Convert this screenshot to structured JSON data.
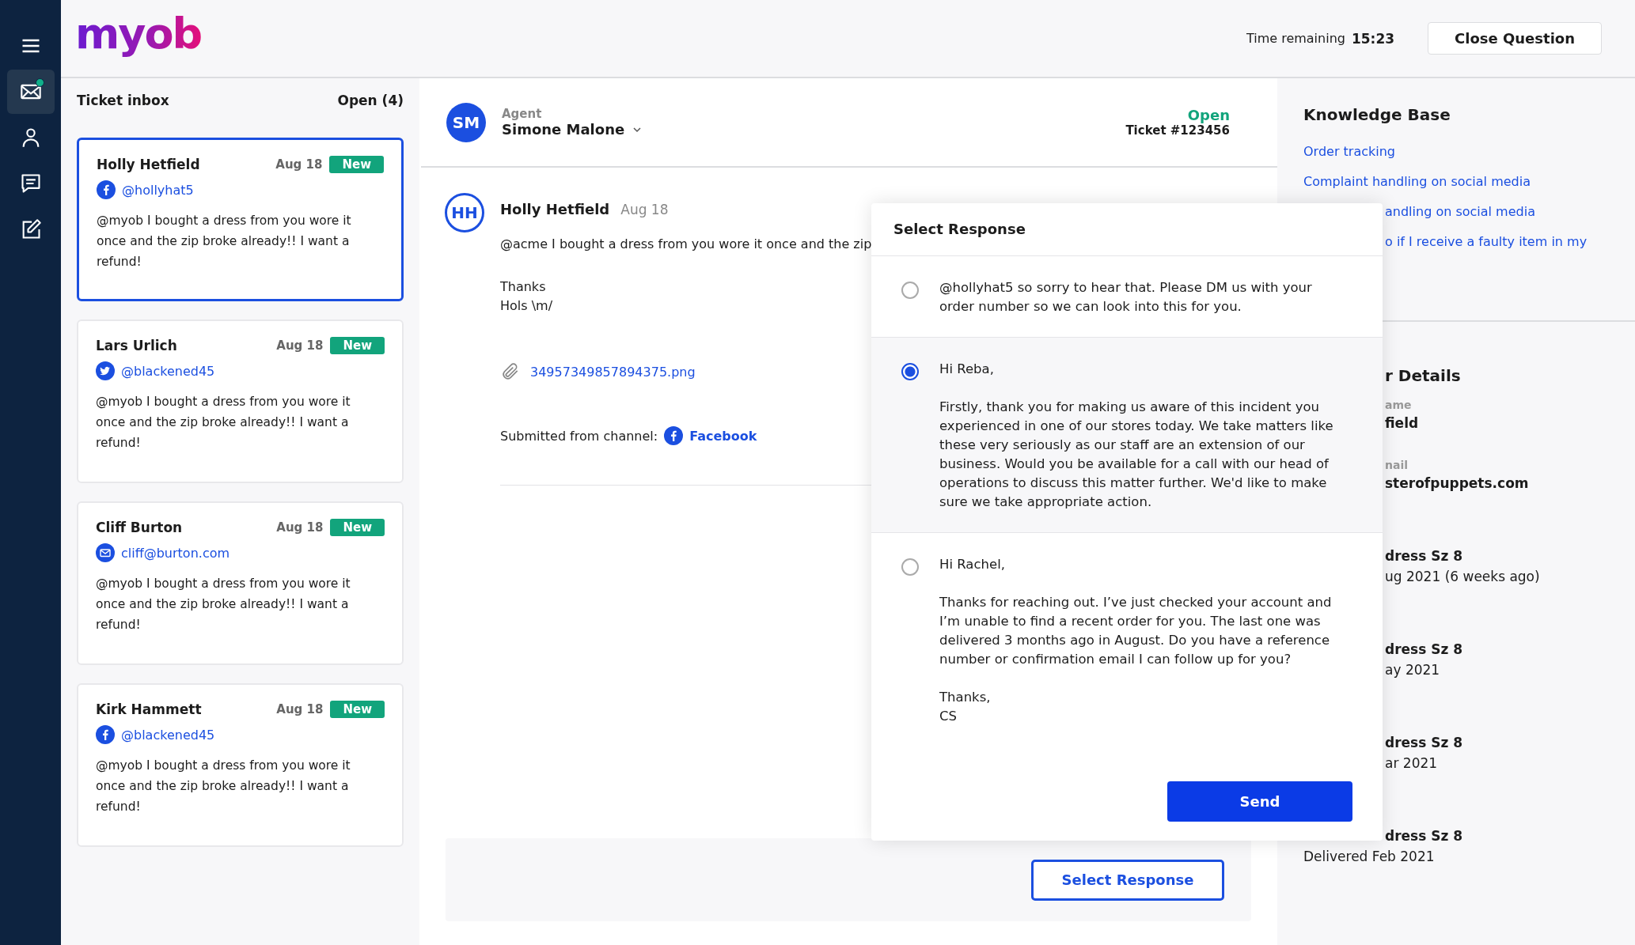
{
  "sidebar": {
    "nav": [
      {
        "selected": false,
        "notification": false
      },
      {
        "selected": true,
        "notification": true
      },
      {
        "selected": false,
        "notification": false
      },
      {
        "selected": false,
        "notification": false
      },
      {
        "selected": false,
        "notification": false
      }
    ]
  },
  "header": {
    "logo": "myob",
    "timer_label": "Time remaining",
    "timer_value": "15:23",
    "close_button": "Close Question"
  },
  "inbox": {
    "title": "Ticket inbox",
    "count": "Open (4)",
    "tickets": [
      {
        "name": "Holly Hetfield",
        "date": "Aug 18",
        "badge": "New",
        "kind": "facebook",
        "handle": "@hollyhat5",
        "text": "@myob I bought a dress from you wore it once and the zip broke already!! I want a refund!",
        "selected": true
      },
      {
        "name": "Lars Urlich",
        "date": "Aug 18",
        "badge": "New",
        "kind": "twitter",
        "handle": "@blackened45",
        "text": "@myob I bought a dress from you wore it once and the zip broke already!! I want a refund!",
        "selected": false
      },
      {
        "name": "Cliff Burton",
        "date": "Aug 18",
        "badge": "New",
        "kind": "email",
        "handle": "cliff@burton.com",
        "text": "@myob I bought a dress from you wore it once and the zip broke already!! I want a refund!",
        "selected": false
      },
      {
        "name": "Kirk Hammett",
        "date": "Aug 18",
        "badge": "New",
        "kind": "facebook",
        "handle": "@blackened45",
        "text": "@myob I bought a dress from you wore it once and the zip broke already!! I want a refund!",
        "selected": false
      }
    ]
  },
  "ticket": {
    "agent": {
      "initials": "SM",
      "label": "Agent",
      "name": "Simone Malone"
    },
    "status": "Open",
    "number": "Ticket #123456",
    "message": {
      "initials": "HH",
      "author": "Holly Hetfield",
      "date": "Aug 18",
      "paragraphs": [
        "@acme I bought a dress from you wore it once and the zip",
        "Thanks\nHols \\m/"
      ],
      "attachment": "34957349857894375.png",
      "channel_label": "Submitted from channel:",
      "channel": {
        "kind": "facebook",
        "name": "Facebook"
      }
    },
    "reply_button": "Select Response"
  },
  "knowledge_base": {
    "title": "Knowledge Base",
    "links": [
      "Order tracking",
      "Complaint handling on social media",
      "andling on social media",
      "o if I receive a faulty item in my"
    ]
  },
  "customer": {
    "title": "r Details",
    "fields": [
      {
        "label": "ame",
        "value": "field"
      },
      {
        "label": "nail",
        "value": "sterofpuppets.com"
      }
    ],
    "orders": [
      {
        "item": "dress Sz 8",
        "date": "ug 2021 (6 weeks ago)"
      },
      {
        "item": "dress Sz 8",
        "date": "ay 2021"
      },
      {
        "item": "dress Sz 8",
        "date": "ar 2021"
      },
      {
        "item": "dress Sz 8",
        "date": "Delivered Feb 2021"
      }
    ]
  },
  "modal": {
    "title": "Select Response",
    "options": [
      {
        "selected": false,
        "paragraphs": [
          "@hollyhat5 so sorry to hear that. Please DM us with your order number so we can look into this for you."
        ]
      },
      {
        "selected": true,
        "paragraphs": [
          "Hi Reba,",
          "Firstly, thank you for making us aware of this incident you experienced in one of our stores today. We take matters like these very seriously as our staff are an extension of our business. Would you be available for a call with our head of operations to discuss this matter further. We'd like to make sure we take appropriate action."
        ]
      },
      {
        "selected": false,
        "paragraphs": [
          "Hi Rachel,",
          "Thanks for reaching out. I’ve just checked your account and I’m unable to find a recent order for you. The last one was delivered 3 months ago in August. Do you have a reference number or confirmation email I can follow up for you?",
          "Thanks,\nCS"
        ]
      }
    ],
    "send_button": "Send"
  }
}
